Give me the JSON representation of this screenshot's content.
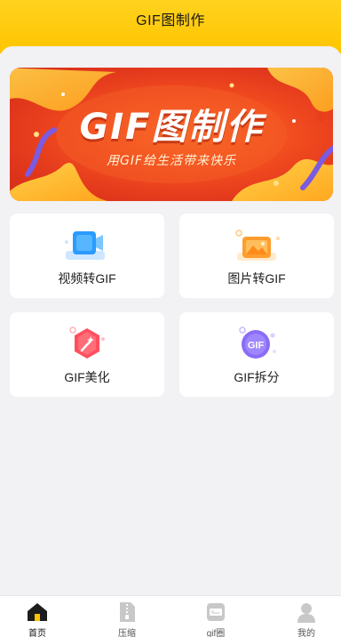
{
  "header": {
    "title": "GIF图制作"
  },
  "banner": {
    "title": "GIF图制作",
    "subtitle": "用GIF给生活带来快乐"
  },
  "features": [
    {
      "label": "视频转GIF",
      "icon": "video-icon"
    },
    {
      "label": "图片转GIF",
      "icon": "image-icon"
    },
    {
      "label": "GIF美化",
      "icon": "magic-wand-icon"
    },
    {
      "label": "GIF拆分",
      "icon": "gif-split-icon"
    }
  ],
  "split_icon_text": "GIF",
  "tabbar": {
    "items": [
      {
        "label": "首页",
        "icon": "home-icon",
        "active": true
      },
      {
        "label": "压缩",
        "icon": "compress-icon",
        "active": false
      },
      {
        "label": "gif圈",
        "icon": "gif-circle-icon",
        "active": false
      },
      {
        "label": "我的",
        "icon": "profile-icon",
        "active": false
      }
    ]
  },
  "colors": {
    "header": "#ffcc00",
    "banner": "#e8401c",
    "background": "#f2f1f4"
  }
}
